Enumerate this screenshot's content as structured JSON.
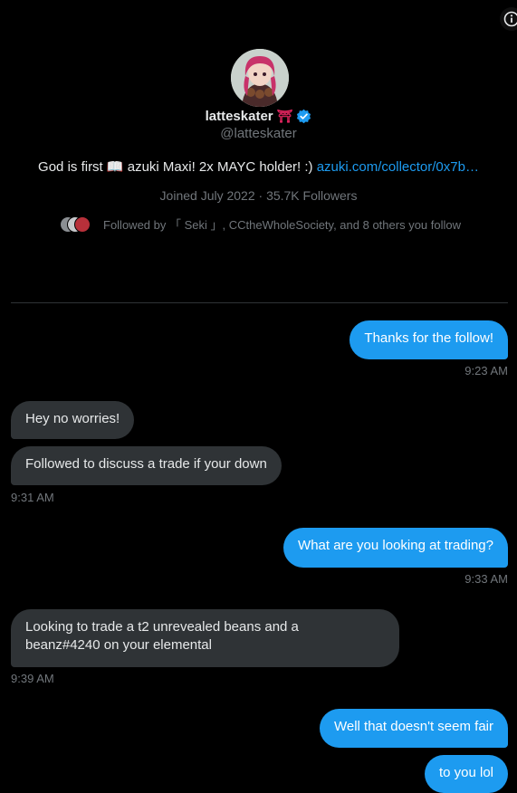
{
  "profile": {
    "name": "latteskater",
    "name_emoji": "⛩",
    "handle": "@latteskater",
    "bio_text": "God is first 📖  azuki Maxi! 2x MAYC holder! :)",
    "bio_link": "azuki.com/collector/0x7b…",
    "joined": "Joined July 2022 · 35.7K Followers",
    "followed_by": "Followed by 「 Seki 」, CCtheWholeSociety, and 8 others you follow"
  },
  "colors": {
    "accent": "#1d9bf0",
    "incoming_bubble": "#2f3336",
    "background": "#000000",
    "muted": "#71767b"
  },
  "icons": {
    "info": "info-icon",
    "verified": "verified-badge-icon"
  },
  "messages": [
    {
      "dir": "out",
      "text": "Thanks for the follow!"
    },
    {
      "time": "9:23 AM"
    },
    {
      "dir": "in",
      "text": "Hey no worries!"
    },
    {
      "dir": "in",
      "text": "Followed to discuss a trade if your down"
    },
    {
      "time": "9:31 AM"
    },
    {
      "dir": "out",
      "text": "What are you looking at trading?"
    },
    {
      "time": "9:33 AM"
    },
    {
      "dir": "in",
      "text": "Looking to trade a t2 unrevealed beans and a"
    },
    {
      "dir": "in",
      "text": "beanz#4240 on your elemental"
    },
    {
      "time": "9:39 AM"
    },
    {
      "dir": "out",
      "text": "Well that doesn't seem fair"
    },
    {
      "dir": "out",
      "text": "to you lol"
    }
  ]
}
